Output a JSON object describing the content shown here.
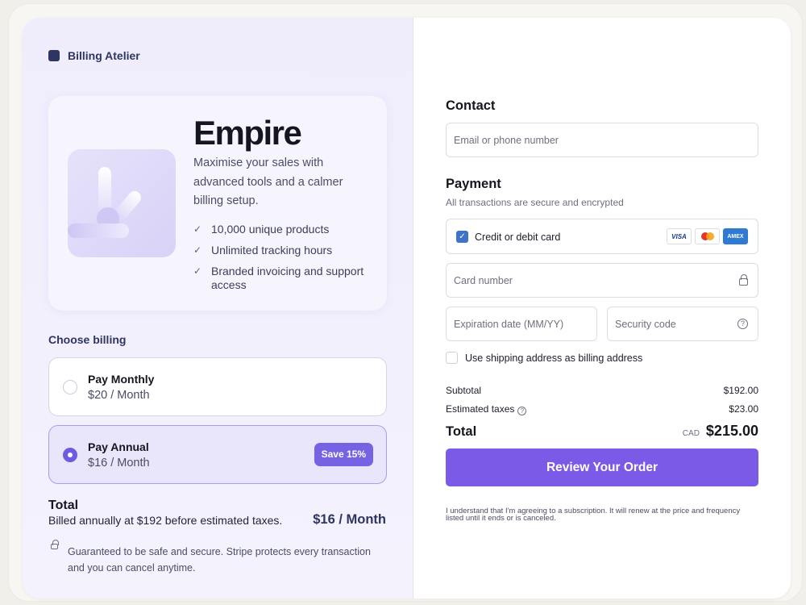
{
  "brand": {
    "name": "Billing Atelier"
  },
  "plan": {
    "title": "Empire",
    "description": "Maximise your sales with advanced tools and a calmer billing setup.",
    "features": [
      "10,000 unique products",
      "Unlimited tracking hours",
      "Branded invoicing and support access"
    ]
  },
  "billing": {
    "heading": "Choose billing",
    "options": [
      {
        "name": "Pay Monthly",
        "price": "$20 / Month",
        "selected": false
      },
      {
        "name": "Pay Annual",
        "price": "$16 / Month",
        "selected": true,
        "badge": "Save 15%"
      }
    ]
  },
  "summary_left": {
    "title": "Total",
    "detail": "Billed annually at $192 before estimated taxes.",
    "amount": "$16 / Month",
    "guarantee": "Guaranteed to be safe and secure. Stripe protects every transaction and you can cancel anytime."
  },
  "contact": {
    "heading": "Contact",
    "email_placeholder": "Email or phone number"
  },
  "payment": {
    "heading": "Payment",
    "subtitle": "All transactions are secure and encrypted",
    "method_label": "Credit or debit card",
    "card_logos": [
      "VISA",
      "mastercard",
      "AMEX"
    ],
    "card_number_placeholder": "Card number",
    "expiry_placeholder": "Expiration date (MM/YY)",
    "cvc_placeholder": "Security code",
    "shipping_label": "Use shipping address as billing address"
  },
  "order": {
    "subtotal_label": "Subtotal",
    "subtotal": "$192.00",
    "taxes_label": "Estimated taxes",
    "taxes": "$23.00",
    "total_label": "Total",
    "currency": "CAD",
    "total": "$215.00",
    "button": "Review Your Order",
    "legal": "I understand that I'm agreeing to a subscription. It will renew at the price and frequency listed until it ends or is canceled."
  },
  "colors": {
    "accent": "#7a5ae6",
    "brand": "#2e3560",
    "badge": "#7563e3",
    "panel": "#efedfc"
  }
}
